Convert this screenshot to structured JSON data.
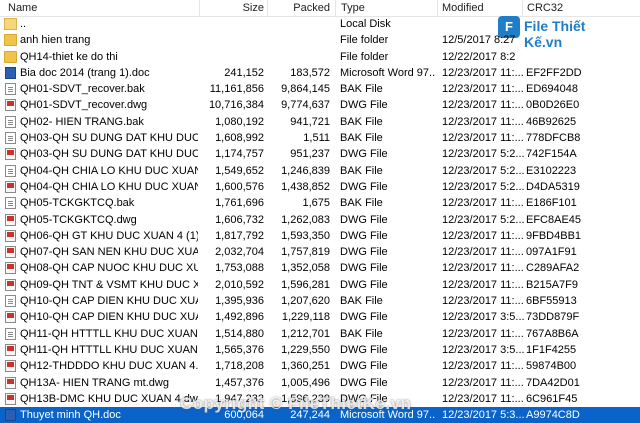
{
  "columns": {
    "name": "Name",
    "size": "Size",
    "packed": "Packed",
    "type": "Type",
    "modified": "Modified",
    "crc": "CRC32"
  },
  "logo": {
    "mark": "F",
    "text": "File Thiết Kế.vn"
  },
  "watermark": "Copyright © FileThietKe.vn",
  "files": [
    {
      "name": "..",
      "size": "",
      "packed": "",
      "type": "Local Disk",
      "modified": "",
      "crc": "",
      "icon": "folder-up-icon"
    },
    {
      "name": "anh hien trang",
      "size": "",
      "packed": "",
      "type": "File folder",
      "modified": "12/5/2017 8:27",
      "crc": "",
      "icon": "folder-icon"
    },
    {
      "name": "QH14-thiet ke do thi",
      "size": "",
      "packed": "",
      "type": "File folder",
      "modified": "12/22/2017 8:2",
      "crc": "",
      "icon": "folder-icon"
    },
    {
      "name": "Bia doc 2014 (trang 1).doc",
      "size": "241,152",
      "packed": "183,572",
      "type": "Microsoft Word 97...",
      "modified": "12/23/2017 11:...",
      "crc": "EF2FF2DD",
      "icon": "word-doc-icon"
    },
    {
      "name": "QH01-SDVT_recover.bak",
      "size": "11,161,856",
      "packed": "9,864,145",
      "type": "BAK File",
      "modified": "12/23/2017 11:...",
      "crc": "ED694048",
      "icon": "bak-file-icon"
    },
    {
      "name": "QH01-SDVT_recover.dwg",
      "size": "10,716,384",
      "packed": "9,774,637",
      "type": "DWG File",
      "modified": "12/23/2017 11:...",
      "crc": "0B0D26E0",
      "icon": "dwg-file-icon"
    },
    {
      "name": "QH02- HIEN TRANG.bak",
      "size": "1,080,192",
      "packed": "941,721",
      "type": "BAK File",
      "modified": "12/23/2017 11:...",
      "crc": "46B92625",
      "icon": "bak-file-icon"
    },
    {
      "name": "QH03-QH SU DUNG DAT KHU DUC X...",
      "size": "1,608,992",
      "packed": "1,511",
      "type": "BAK File",
      "modified": "12/23/2017 11:...",
      "crc": "778DFCB8",
      "icon": "bak-file-icon"
    },
    {
      "name": "QH03-QH SU DUNG DAT KHU DUC X...",
      "size": "1,174,757",
      "packed": "951,237",
      "type": "DWG File",
      "modified": "12/23/2017 5:2...",
      "crc": "742F154A",
      "icon": "dwg-file-icon"
    },
    {
      "name": "QH04-QH CHIA LO KHU DUC XUAN 4...",
      "size": "1,549,652",
      "packed": "1,246,839",
      "type": "BAK File",
      "modified": "12/23/2017 5:2...",
      "crc": "E3102223",
      "icon": "bak-file-icon"
    },
    {
      "name": "QH04-QH CHIA LO KHU DUC XUAN 4...",
      "size": "1,600,576",
      "packed": "1,438,852",
      "type": "DWG File",
      "modified": "12/23/2017 5:2...",
      "crc": "D4DA5319",
      "icon": "dwg-file-icon"
    },
    {
      "name": "QH05-TCKGKTCQ.bak",
      "size": "1,761,696",
      "packed": "1,675",
      "type": "BAK File",
      "modified": "12/23/2017 11:...",
      "crc": "E186F101",
      "icon": "bak-file-icon"
    },
    {
      "name": "QH05-TCKGKTCQ.dwg",
      "size": "1,606,732",
      "packed": "1,262,083",
      "type": "DWG File",
      "modified": "12/23/2017 5:2...",
      "crc": "EFC8AE45",
      "icon": "dwg-file-icon"
    },
    {
      "name": "QH06-QH GT KHU DUC XUAN 4 (1).d",
      "size": "1,817,792",
      "packed": "1,593,350",
      "type": "DWG File",
      "modified": "12/23/2017 11:...",
      "crc": "9FBD4BB1",
      "icon": "dwg-file-icon"
    },
    {
      "name": "QH07-QH SAN NEN KHU DUC XUAN ...",
      "size": "2,032,704",
      "packed": "1,757,819",
      "type": "DWG File",
      "modified": "12/23/2017 11:...",
      "crc": "097A1F91",
      "icon": "dwg-file-icon"
    },
    {
      "name": "QH08-QH CAP NUOC KHU DUC XUAN...",
      "size": "1,753,088",
      "packed": "1,352,058",
      "type": "DWG File",
      "modified": "12/23/2017 11:...",
      "crc": "C289AFA2",
      "icon": "dwg-file-icon"
    },
    {
      "name": "QH09-QH TNT & VSMT KHU DUC XU...",
      "size": "2,010,592",
      "packed": "1,596,281",
      "type": "DWG File",
      "modified": "12/23/2017 11:...",
      "crc": "B215A7F9",
      "icon": "dwg-file-icon"
    },
    {
      "name": "QH10-QH CAP DIEN KHU DUC XUAN ...",
      "size": "1,395,936",
      "packed": "1,207,620",
      "type": "BAK File",
      "modified": "12/23/2017 11:...",
      "crc": "6BF55913",
      "icon": "bak-file-icon"
    },
    {
      "name": "QH10-QH CAP DIEN KHU DUC XUAN ...",
      "size": "1,492,896",
      "packed": "1,229,118",
      "type": "DWG File",
      "modified": "12/23/2017 3:5...",
      "crc": "73DD879F",
      "icon": "dwg-file-icon"
    },
    {
      "name": "QH11-QH HTTTLL KHU DUC XUAN 4.",
      "size": "1,514,880",
      "packed": "1,212,701",
      "type": "BAK File",
      "modified": "12/23/2017 11:...",
      "crc": "767A8B6A",
      "icon": "bak-file-icon"
    },
    {
      "name": "QH11-QH HTTTLL KHU DUC XUAN 4.",
      "size": "1,565,376",
      "packed": "1,229,550",
      "type": "DWG File",
      "modified": "12/23/2017 3:5...",
      "crc": "1F1F4255",
      "icon": "dwg-file-icon"
    },
    {
      "name": "QH12-THDDDO KHU DUC XUAN 4.dwg",
      "size": "1,718,208",
      "packed": "1,360,251",
      "type": "DWG File",
      "modified": "12/23/2017 11:...",
      "crc": "59874B00",
      "icon": "dwg-file-icon"
    },
    {
      "name": "QH13A- HIEN TRANG mt.dwg",
      "size": "1,457,376",
      "packed": "1,005,496",
      "type": "DWG File",
      "modified": "12/23/2017 11:...",
      "crc": "7DA42D01",
      "icon": "dwg-file-icon"
    },
    {
      "name": "QH13B-DMC KHU DUC XUAN 4.dwg",
      "size": "1,947,232",
      "packed": "1,596,239",
      "type": "DWG File",
      "modified": "12/23/2017 11:...",
      "crc": "6C961F45",
      "icon": "dwg-file-icon"
    },
    {
      "name": "Thuyet minh QH.doc",
      "size": "600,064",
      "packed": "247,244",
      "type": "Microsoft Word 97...",
      "modified": "12/23/2017 5:3...",
      "crc": "A9974C8D",
      "icon": "word-doc-icon",
      "selected": true
    }
  ]
}
